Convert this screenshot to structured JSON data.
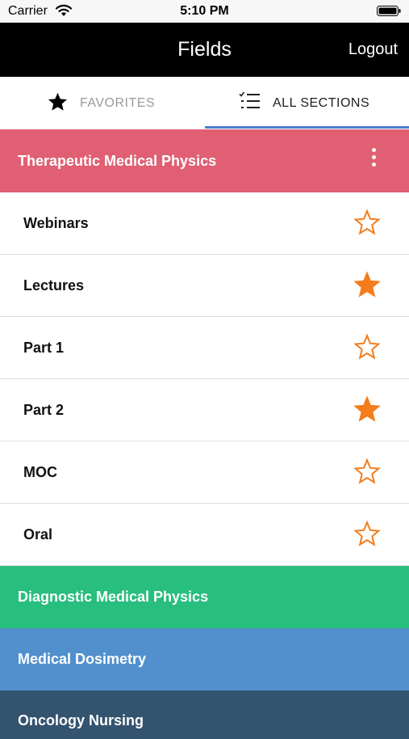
{
  "status_bar": {
    "carrier": "Carrier",
    "time": "5:10 PM"
  },
  "nav": {
    "title": "Fields",
    "logout_label": "Logout"
  },
  "tabs": [
    {
      "label": "FAVORITES",
      "icon": "star-icon",
      "selected": false
    },
    {
      "label": "ALL SECTIONS",
      "icon": "checklist-icon",
      "selected": true
    }
  ],
  "sections": [
    {
      "title": "Therapeutic Medical Physics",
      "color": "#e05f73",
      "expanded": true,
      "items": [
        {
          "label": "Webinars",
          "favorite": false
        },
        {
          "label": "Lectures",
          "favorite": true
        },
        {
          "label": "Part 1",
          "favorite": false
        },
        {
          "label": "Part 2",
          "favorite": true
        },
        {
          "label": "MOC",
          "favorite": false
        },
        {
          "label": "Oral",
          "favorite": false
        }
      ]
    },
    {
      "title": "Diagnostic Medical Physics",
      "color": "#28be7e",
      "expanded": false
    },
    {
      "title": "Medical Dosimetry",
      "color": "#5290cd",
      "expanded": false
    },
    {
      "title": "Oncology Nursing",
      "color": "#34536f",
      "expanded": false
    }
  ],
  "colors": {
    "star": "#f47c1b",
    "tab_underline": "#4a7fd1",
    "nav_background": "#000000"
  }
}
